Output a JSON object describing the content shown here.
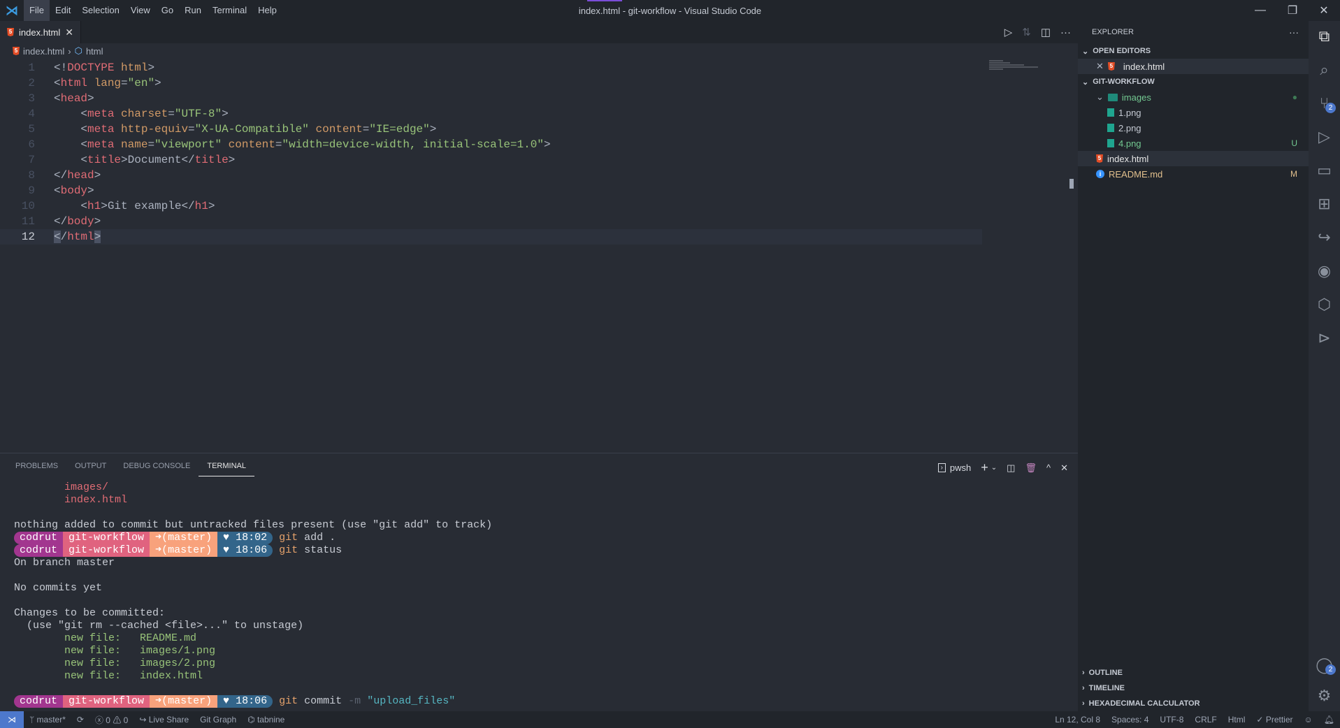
{
  "titlebar": {
    "menu": [
      "File",
      "Edit",
      "Selection",
      "View",
      "Go",
      "Run",
      "Terminal",
      "Help"
    ],
    "title": "index.html - git-workflow - Visual Studio Code"
  },
  "tabs": [
    {
      "label": "index.html",
      "icon": "html5-icon",
      "active": true
    }
  ],
  "breadcrumb": {
    "file": "index.html",
    "symbol": "html"
  },
  "editor": {
    "current_line": 12,
    "lines": [
      [
        [
          "punct",
          "<!"
        ],
        [
          "tag",
          "DOCTYPE"
        ],
        [
          "punct",
          " "
        ],
        [
          "attr",
          "html"
        ],
        [
          "punct",
          ">"
        ]
      ],
      [
        [
          "punct",
          "<"
        ],
        [
          "tag",
          "html"
        ],
        [
          "punct",
          " "
        ],
        [
          "attr",
          "lang"
        ],
        [
          "punct",
          "="
        ],
        [
          "str",
          "\"en\""
        ],
        [
          "punct",
          ">"
        ]
      ],
      [
        [
          "punct",
          "<"
        ],
        [
          "tag",
          "head"
        ],
        [
          "punct",
          ">"
        ]
      ],
      [
        [
          "punct",
          "    <"
        ],
        [
          "tag",
          "meta"
        ],
        [
          "punct",
          " "
        ],
        [
          "attr",
          "charset"
        ],
        [
          "punct",
          "="
        ],
        [
          "str",
          "\"UTF-8\""
        ],
        [
          "punct",
          ">"
        ]
      ],
      [
        [
          "punct",
          "    <"
        ],
        [
          "tag",
          "meta"
        ],
        [
          "punct",
          " "
        ],
        [
          "attr",
          "http-equiv"
        ],
        [
          "punct",
          "="
        ],
        [
          "str",
          "\"X-UA-Compatible\""
        ],
        [
          "punct",
          " "
        ],
        [
          "attr",
          "content"
        ],
        [
          "punct",
          "="
        ],
        [
          "str",
          "\"IE=edge\""
        ],
        [
          "punct",
          ">"
        ]
      ],
      [
        [
          "punct",
          "    <"
        ],
        [
          "tag",
          "meta"
        ],
        [
          "punct",
          " "
        ],
        [
          "attr",
          "name"
        ],
        [
          "punct",
          "="
        ],
        [
          "str",
          "\"viewport\""
        ],
        [
          "punct",
          " "
        ],
        [
          "attr",
          "content"
        ],
        [
          "punct",
          "="
        ],
        [
          "str",
          "\"width=device-width, initial-scale=1.0\""
        ],
        [
          "punct",
          ">"
        ]
      ],
      [
        [
          "punct",
          "    <"
        ],
        [
          "tag",
          "title"
        ],
        [
          "punct",
          ">"
        ],
        [
          "text",
          "Document"
        ],
        [
          "punct",
          "</"
        ],
        [
          "tag",
          "title"
        ],
        [
          "punct",
          ">"
        ]
      ],
      [
        [
          "punct",
          "</"
        ],
        [
          "tag",
          "head"
        ],
        [
          "punct",
          ">"
        ]
      ],
      [
        [
          "punct",
          "<"
        ],
        [
          "tag",
          "body"
        ],
        [
          "punct",
          ">"
        ]
      ],
      [
        [
          "punct",
          "    <"
        ],
        [
          "tag",
          "h1"
        ],
        [
          "punct",
          ">"
        ],
        [
          "text",
          "Git example"
        ],
        [
          "punct",
          "</"
        ],
        [
          "tag",
          "h1"
        ],
        [
          "punct",
          ">"
        ]
      ],
      [
        [
          "punct",
          "</"
        ],
        [
          "tag",
          "body"
        ],
        [
          "punct",
          ">"
        ]
      ],
      [
        [
          "sel",
          "<"
        ],
        [
          "punct",
          "/"
        ],
        [
          "tag",
          "html"
        ],
        [
          "sel",
          ">"
        ]
      ]
    ]
  },
  "panel": {
    "tabs": [
      "PROBLEMS",
      "OUTPUT",
      "DEBUG CONSOLE",
      "TERMINAL"
    ],
    "active_tab": "TERMINAL",
    "shell": "pwsh"
  },
  "terminal": {
    "prompt_colors": [
      "#a2368f",
      "#e0637f",
      "#f8a27c",
      "#33658a"
    ],
    "lines": [
      [
        [
          "red",
          "        images/"
        ]
      ],
      [
        [
          "red",
          "        index.html"
        ]
      ],
      [],
      [
        [
          "plain",
          "nothing added to commit but untracked files present (use \"git add\" to track)"
        ]
      ],
      {
        "prompt": [
          "codrut",
          "git-workflow",
          "➜(master)",
          "♥ 18:02"
        ],
        "cmd": [
          [
            "orange",
            "git"
          ],
          [
            "plain",
            " add ."
          ]
        ]
      },
      {
        "prompt": [
          "codrut",
          "git-workflow",
          "➜(master)",
          "♥ 18:06"
        ],
        "cmd": [
          [
            "orange",
            "git"
          ],
          [
            "plain",
            " status"
          ]
        ]
      },
      [
        [
          "plain",
          "On branch master"
        ]
      ],
      [],
      [
        [
          "plain",
          "No commits yet"
        ]
      ],
      [],
      [
        [
          "plain",
          "Changes to be committed:"
        ]
      ],
      [
        [
          "plain",
          "  (use \"git rm --cached <file>...\" to unstage)"
        ]
      ],
      [
        [
          "green",
          "        new file:   README.md"
        ]
      ],
      [
        [
          "green",
          "        new file:   images/1.png"
        ]
      ],
      [
        [
          "green",
          "        new file:   images/2.png"
        ]
      ],
      [
        [
          "green",
          "        new file:   index.html"
        ]
      ],
      [],
      {
        "prompt": [
          "codrut",
          "git-workflow",
          "➜(master)",
          "♥ 18:06"
        ],
        "cmd": [
          [
            "orange",
            "git"
          ],
          [
            "plain",
            " commit "
          ],
          [
            "dim",
            "-m"
          ],
          [
            "plain",
            " "
          ],
          [
            "cyan",
            "\"upload_files\""
          ]
        ]
      }
    ]
  },
  "sidebar": {
    "title": "EXPLORER",
    "open_editors": {
      "label": "OPEN EDITORS",
      "items": [
        "index.html"
      ]
    },
    "workspace": {
      "label": "GIT-WORKFLOW",
      "tree": [
        {
          "name": "images",
          "type": "folder",
          "depth": 1,
          "color": "#73c991",
          "decoration": "●",
          "deco_color": "#3e7a55"
        },
        {
          "name": "1.png",
          "type": "png",
          "depth": 2,
          "color": "#c5cad3",
          "decoration": ""
        },
        {
          "name": "2.png",
          "type": "png",
          "depth": 2,
          "color": "#c5cad3",
          "decoration": ""
        },
        {
          "name": "4.png",
          "type": "png",
          "depth": 2,
          "color": "#73c991",
          "decoration": "U",
          "deco_color": "#73c991"
        },
        {
          "name": "index.html",
          "type": "html",
          "depth": 1,
          "color": "#e6e6e6",
          "decoration": "",
          "selected": true
        },
        {
          "name": "README.md",
          "type": "info",
          "depth": 1,
          "color": "#e2c08d",
          "decoration": "M",
          "deco_color": "#e2c08d"
        }
      ]
    },
    "bottom_sections": [
      "OUTLINE",
      "TIMELINE",
      "HEXADECIMAL CALCULATOR"
    ]
  },
  "activity_bar": {
    "top": [
      "explorer-icon",
      "search-icon",
      "source-control-icon",
      "run-debug-icon",
      "remote-explorer-icon",
      "extensions-icon",
      "live-share-icon",
      "github-icon",
      "hexagon-icon",
      "terminal-icon"
    ],
    "source_control_badge": "2",
    "accounts_badge": "2"
  },
  "statusbar": {
    "branch": "master*",
    "errors": "0",
    "warnings": "0",
    "live_share": "Live Share",
    "git_graph": "Git Graph",
    "tabnine": "tabnine",
    "position": "Ln 12, Col 8",
    "spaces": "Spaces: 4",
    "encoding": "UTF-8",
    "eol": "CRLF",
    "language": "Html",
    "prettier": "Prettier"
  }
}
